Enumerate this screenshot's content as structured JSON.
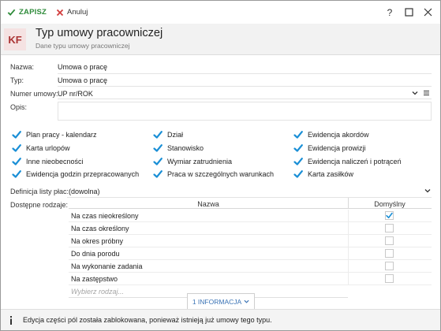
{
  "toolbar": {
    "save_label": "ZAPISZ",
    "cancel_label": "Anuluj",
    "help_glyph": "?"
  },
  "header": {
    "logo_text": "KF",
    "title": "Typ umowy pracowniczej",
    "subtitle": "Dane typu umowy pracowniczej"
  },
  "form": {
    "nazwa_label": "Nazwa:",
    "nazwa_value": "Umowa o pracę",
    "typ_label": "Typ:",
    "typ_value": "Umowa o pracę",
    "numer_label": "Numer umowy:",
    "numer_value": "UP nr/ROK",
    "opis_label": "Opis:",
    "opis_value": ""
  },
  "checkboxes": [
    {
      "label": "Plan pracy - kalendarz",
      "checked": true
    },
    {
      "label": "Karta urlopów",
      "checked": true
    },
    {
      "label": "Inne nieobecności",
      "checked": true
    },
    {
      "label": "Ewidencja godzin przepracowanych",
      "checked": true
    },
    {
      "label": "Dział",
      "checked": true
    },
    {
      "label": "Stanowisko",
      "checked": true
    },
    {
      "label": "Wymiar zatrudnienia",
      "checked": true
    },
    {
      "label": "Praca w szczególnych warunkach",
      "checked": true
    },
    {
      "label": "Ewidencja akordów",
      "checked": true
    },
    {
      "label": "Ewidencja prowizji",
      "checked": true
    },
    {
      "label": "Ewidencja naliczeń i potrąceń",
      "checked": true
    },
    {
      "label": "Karta zasiłków",
      "checked": true
    }
  ],
  "definicja": {
    "label": "Definicja listy płac:",
    "value": "(dowolna)"
  },
  "rodzaje": {
    "label": "Dostępne rodzaje:",
    "col_name": "Nazwa",
    "col_default": "Domyślny",
    "rows": [
      {
        "name": "Na czas nieokreślony",
        "default": true
      },
      {
        "name": "Na czas określony",
        "default": false
      },
      {
        "name": "Na okres próbny",
        "default": false
      },
      {
        "name": "Do dnia porodu",
        "default": false
      },
      {
        "name": "Na wykonanie zadania",
        "default": false
      },
      {
        "name": "Na zastępstwo",
        "default": false
      }
    ],
    "picker_placeholder": "Wybierz rodzaj..."
  },
  "info_pill": "1 INFORMACJA",
  "status_message": "Edycja części pól została zablokowana, ponieważ istnieją już umowy tego typu.",
  "colors": {
    "check_blue": "#1a8fd6",
    "save_green": "#2e8b3a",
    "cancel_red": "#d23c3c",
    "logo_bg": "#f5e2e2",
    "logo_fg": "#a33333",
    "link_blue": "#3a73b5"
  }
}
